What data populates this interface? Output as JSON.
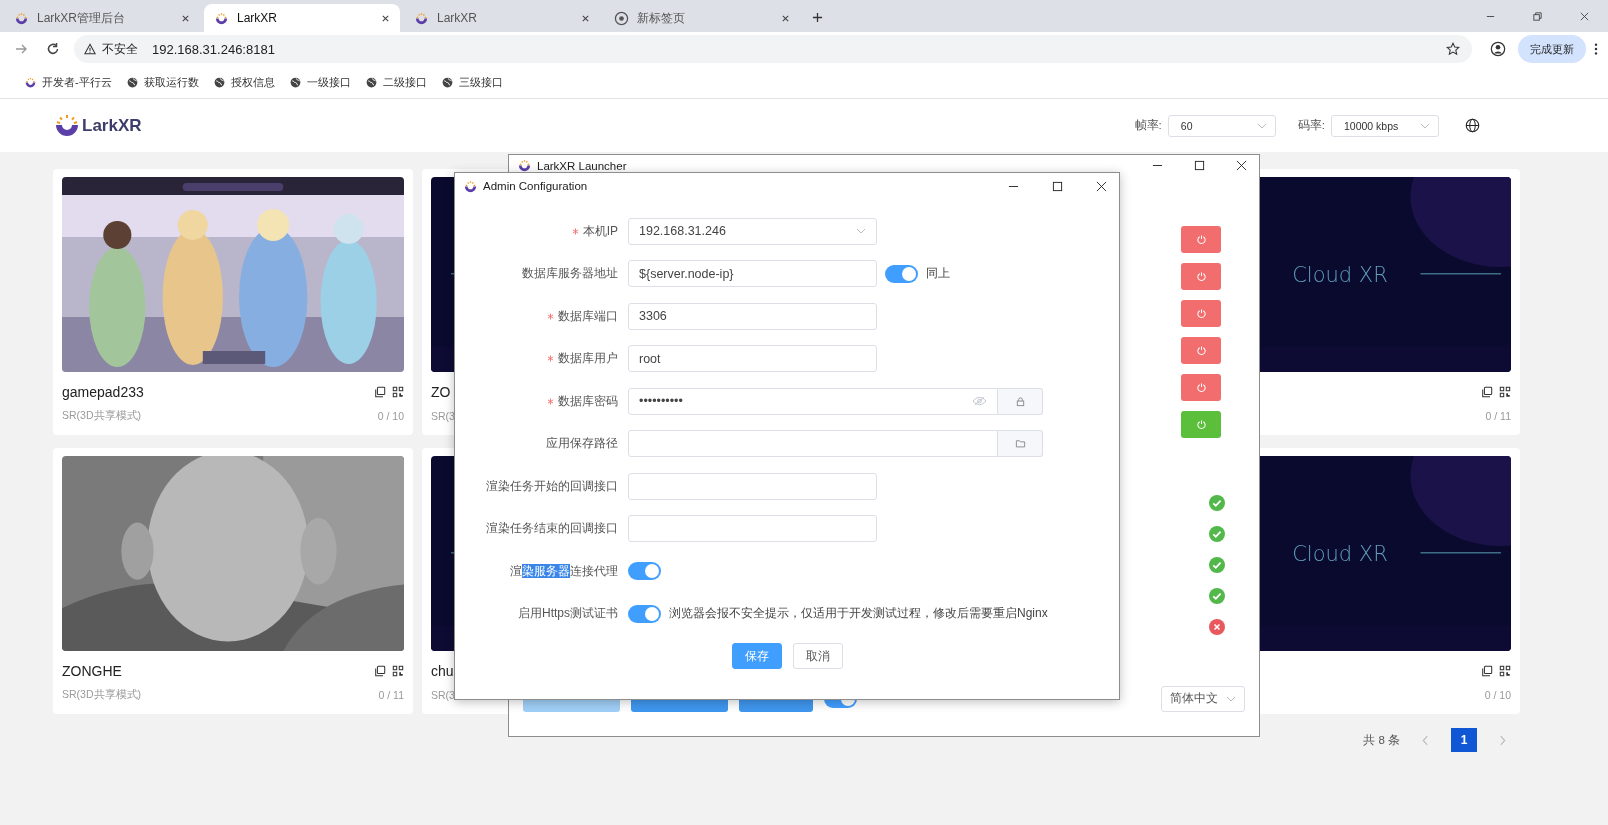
{
  "browser": {
    "tabs": [
      {
        "label": "LarkXR管理后台",
        "selected": false
      },
      {
        "label": "LarkXR",
        "selected": true
      },
      {
        "label": "LarkXR",
        "selected": false
      },
      {
        "label": "新标签页",
        "selected": false
      }
    ],
    "security": "不安全",
    "url": "192.168.31.246:8181",
    "update_button": "完成更新",
    "bookmarks": [
      "开发者-平行云",
      "获取运行数",
      "授权信息",
      "一级接口",
      "二级接口",
      "三级接口"
    ]
  },
  "header": {
    "logo": "LarkXR",
    "settings": [
      {
        "label": "帧率:",
        "value": "60"
      },
      {
        "label": "码率:",
        "value": "10000 kbps"
      }
    ]
  },
  "cards": [
    {
      "cover": {
        "kind": "game"
      },
      "name": "gamepad233",
      "mode": "SR(3D共享模式)",
      "count": "0 / 10"
    },
    {
      "cover": {
        "kind": "cloud"
      },
      "name": "ZO",
      "mode": "SR(3"
    },
    {
      "cover": {
        "kind": "cloud",
        "text": "Cloud XR"
      },
      "count": "0 / 11"
    },
    {
      "cover": {
        "kind": "portrait"
      },
      "name": "ZONGHE",
      "mode": "SR(3D共享模式)",
      "count": "0 / 11"
    },
    {
      "cover": {
        "kind": "cloud"
      },
      "name": "chu",
      "mode": "SR(3"
    },
    {
      "cover": {
        "kind": "cloud",
        "text": "Cloud XR"
      },
      "count": "0 / 10"
    }
  ],
  "pagination": {
    "total": "共 8 条",
    "pages": [
      {
        "label": "1",
        "selected": true
      }
    ]
  },
  "launcher": {
    "title": "LarkXR Launcher",
    "power_buttons": [
      {
        "running": true
      },
      {
        "running": true
      },
      {
        "running": true
      },
      {
        "running": true
      },
      {
        "running": true
      },
      {
        "running": false
      }
    ],
    "checks": [
      {
        "ok": true
      },
      {
        "ok": true
      },
      {
        "ok": true
      },
      {
        "ok": true
      },
      {
        "ok": false
      }
    ],
    "actions": [
      {
        "disabled": true
      },
      {
        "disabled": false
      },
      {
        "disabled": false
      }
    ],
    "autostart": {
      "on": true
    },
    "language": "简体中文"
  },
  "dialog": {
    "title": "Admin Configuration",
    "fields": [
      {
        "kind": "select",
        "label": "本机IP",
        "required": true,
        "value": "192.168.31.246"
      },
      {
        "kind": "input",
        "label": "数据库服务器地址",
        "required": false,
        "value": "${server.node-ip}",
        "switch": {
          "on": true,
          "label": "同上"
        }
      },
      {
        "kind": "input",
        "label": "数据库端口",
        "required": true,
        "value": "3306"
      },
      {
        "kind": "input",
        "label": "数据库用户",
        "required": true,
        "value": "root"
      },
      {
        "kind": "password",
        "label": "数据库密码",
        "required": true,
        "value": "••••••••••"
      },
      {
        "kind": "path",
        "label": "应用保存路径",
        "required": false
      },
      {
        "kind": "input",
        "label": "渲染任务开始的回调接口",
        "required": false
      },
      {
        "kind": "input",
        "label": "渲染任务结束的回调接口",
        "required": false
      },
      {
        "kind": "switch",
        "label_parts": [
          {
            "text": "渲",
            "highlighted": false
          },
          {
            "text": "染服务器",
            "highlighted": true
          },
          {
            "text": "连接代理",
            "highlighted": false
          }
        ],
        "required": false,
        "on": true
      },
      {
        "kind": "switch",
        "label": "启用Https测试证书",
        "required": false,
        "on": true,
        "note": "浏览器会报不安全提示，仅适用于开发测试过程，修改后需要重启Nginx"
      }
    ],
    "buttons": [
      {
        "label": "保存",
        "primary": true
      },
      {
        "label": "取消",
        "primary": false
      }
    ]
  }
}
